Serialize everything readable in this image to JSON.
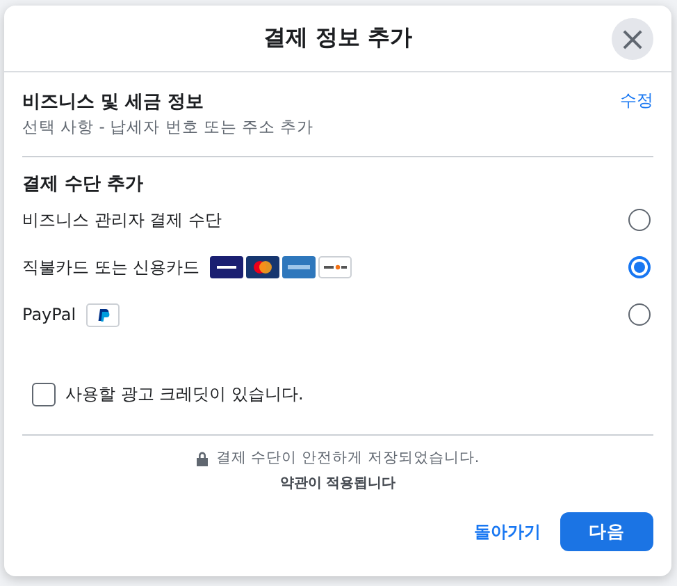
{
  "dialog": {
    "title": "결제 정보 추가",
    "close": "×"
  },
  "business_info": {
    "title": "비즈니스 및 세금 정보",
    "subtitle": "선택 사항 - 납세자 번호 또는 주소 추가",
    "edit_link": "수정"
  },
  "payment_section": {
    "title": "결제 수단 추가",
    "methods": [
      {
        "label": "비즈니스 관리자 결제 수단",
        "kind": "plain",
        "selected": false
      },
      {
        "label": "직불카드 또는 신용카드",
        "kind": "cards",
        "selected": true
      },
      {
        "label": "PayPal",
        "kind": "paypal",
        "selected": false
      }
    ]
  },
  "ad_credit": {
    "label": "사용할 광고 크레딧이 있습니다.",
    "checked": false
  },
  "security_note": "결제 수단이 안전하게 저장되었습니다.",
  "terms": "약관이 적용됩니다",
  "buttons": {
    "back": "돌아가기",
    "next": "다음"
  }
}
